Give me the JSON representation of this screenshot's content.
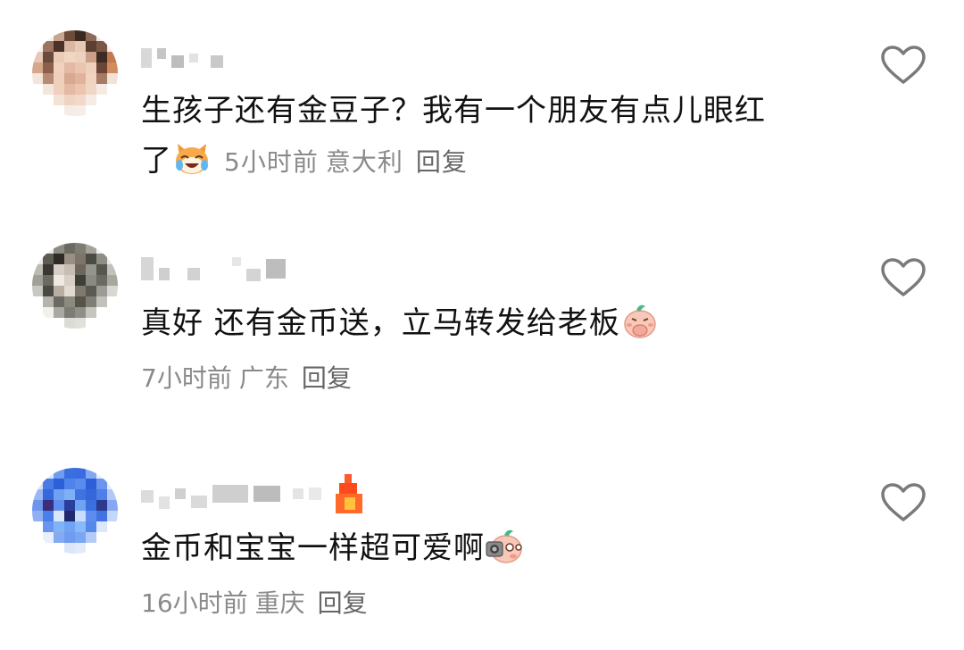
{
  "comments": [
    {
      "text_line1": "生孩子还有金豆子？我有一个朋友有点儿眼红",
      "text_line2": "了",
      "emoji": "laughing-cat-emoji",
      "time": "5小时前",
      "location": "意大利",
      "reply_label": "回复"
    },
    {
      "text": "真好 还有金币送，立马转发给老板",
      "emoji": "peach-cover-mouth-emoji",
      "time": "7小时前",
      "location": "广东",
      "reply_label": "回复"
    },
    {
      "text": "金币和宝宝一样超可爱啊",
      "emoji": "peach-camera-emoji",
      "time": "16小时前",
      "location": "重庆",
      "reply_label": "回复"
    }
  ],
  "icons": {
    "like": "heart-outline-icon"
  },
  "colors": {
    "text": "#111111",
    "meta": "#8a8a8a",
    "icon": "#7a7a7a"
  }
}
